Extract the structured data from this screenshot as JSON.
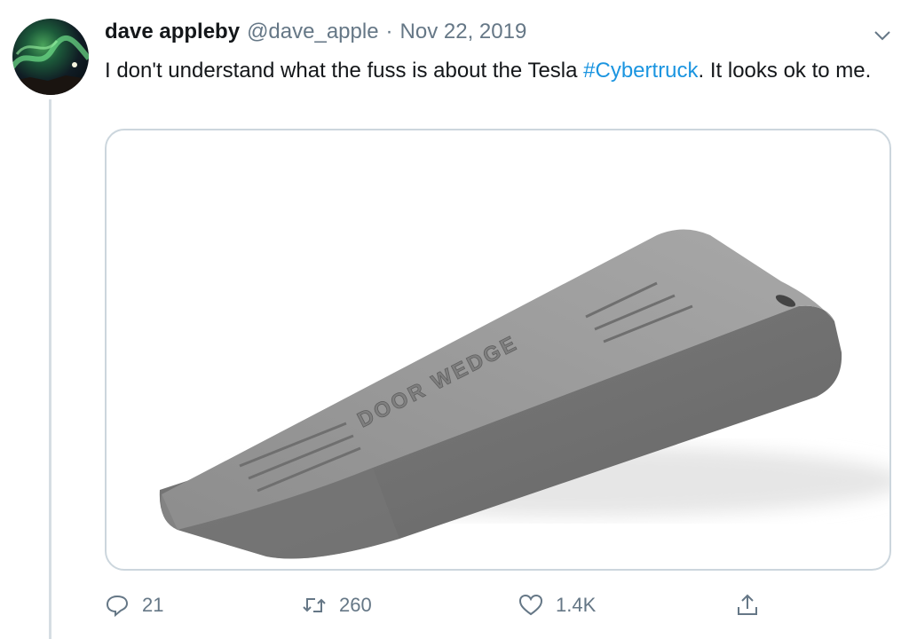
{
  "tweet": {
    "author_name": "dave appleby",
    "author_handle": "@dave_apple",
    "separator": "·",
    "date": "Nov 22, 2019",
    "text_before": "I don't understand what the fuss is about the Tesla ",
    "hashtag": "#Cybertruck",
    "text_after": ". It looks ok to me.",
    "image_text": "DOOR WEDGE"
  },
  "actions": {
    "reply_count": "21",
    "retweet_count": "260",
    "like_count": "1.4K"
  },
  "icons": {
    "reply": "speech-bubble-icon",
    "retweet": "retweet-arrows-icon",
    "like": "heart-outline-icon",
    "share": "share-upload-icon",
    "more": "chevron-down-icon"
  },
  "colors": {
    "hashtag": "#1b95e0",
    "secondary_text": "#657786",
    "border": "#ccd6dd"
  }
}
